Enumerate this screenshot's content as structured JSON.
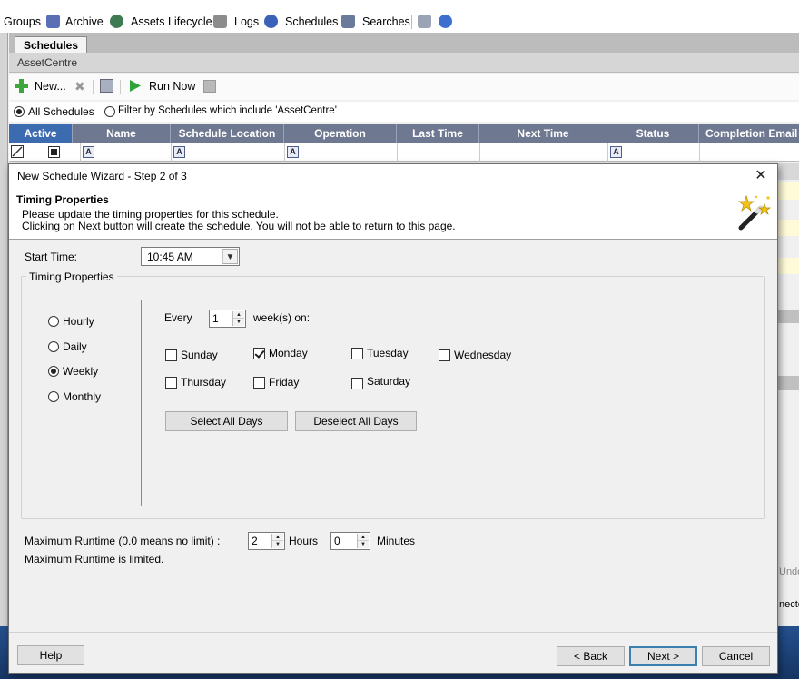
{
  "menubar": {
    "items": [
      {
        "label": "Groups",
        "icon": "groups-icon"
      },
      {
        "label": "Archive",
        "icon": "archive-icon"
      },
      {
        "label": "Assets Lifecycle",
        "icon": "assets-lifecycle-icon"
      },
      {
        "label": "Logs",
        "icon": "logs-icon"
      },
      {
        "label": "Schedules",
        "icon": "schedules-icon"
      },
      {
        "label": "Searches",
        "icon": "searches-icon"
      }
    ]
  },
  "tabs": {
    "active": "Schedules"
  },
  "breadcrumb": "AssetCentre",
  "toolbar": {
    "new_label": "New...",
    "run_now_label": "Run Now"
  },
  "filter": {
    "all_label": "All Schedules",
    "filter_label": "Filter by Schedules which include 'AssetCentre'",
    "selected": "all"
  },
  "grid": {
    "columns": [
      "Active",
      "Name",
      "Schedule Location",
      "Operation",
      "Last Time",
      "Next Time",
      "Status",
      "Completion Email L"
    ]
  },
  "background_fragments": {
    "undo": "Undo",
    "connected": "necte"
  },
  "dialog": {
    "title": "New Schedule Wizard - Step 2 of 3",
    "header_title": "Timing Properties",
    "header_line1": "Please update the timing properties for this schedule.",
    "header_line2": "Clicking on Next button will create the schedule. You will not be able to return to this page.",
    "start_time_label": "Start Time:",
    "start_time_value": "10:45 AM",
    "group_label": "Timing Properties",
    "frequency": {
      "hourly": "Hourly",
      "daily": "Daily",
      "weekly": "Weekly",
      "monthly": "Monthly",
      "selected": "weekly"
    },
    "every_label": "Every",
    "every_value": "1",
    "weeks_on_label": "week(s) on:",
    "days": {
      "sunday": {
        "label": "Sunday",
        "checked": false
      },
      "monday": {
        "label": "Monday",
        "checked": true
      },
      "tuesday": {
        "label": "Tuesday",
        "checked": false
      },
      "wednesday": {
        "label": "Wednesday",
        "checked": false
      },
      "thursday": {
        "label": "Thursday",
        "checked": false
      },
      "friday": {
        "label": "Friday",
        "checked": false
      },
      "saturday": {
        "label": "Saturday",
        "checked": false
      }
    },
    "select_all_label": "Select All Days",
    "deselect_all_label": "Deselect All Days",
    "max_runtime_label": "Maximum Runtime (0.0 means no limit) :",
    "hours_value": "2",
    "hours_label": "Hours",
    "minutes_value": "0",
    "minutes_label": "Minutes",
    "runtime_status": "Maximum Runtime is limited.",
    "help_label": "Help",
    "back_label": "< Back",
    "next_label": "Next >",
    "cancel_label": "Cancel"
  }
}
